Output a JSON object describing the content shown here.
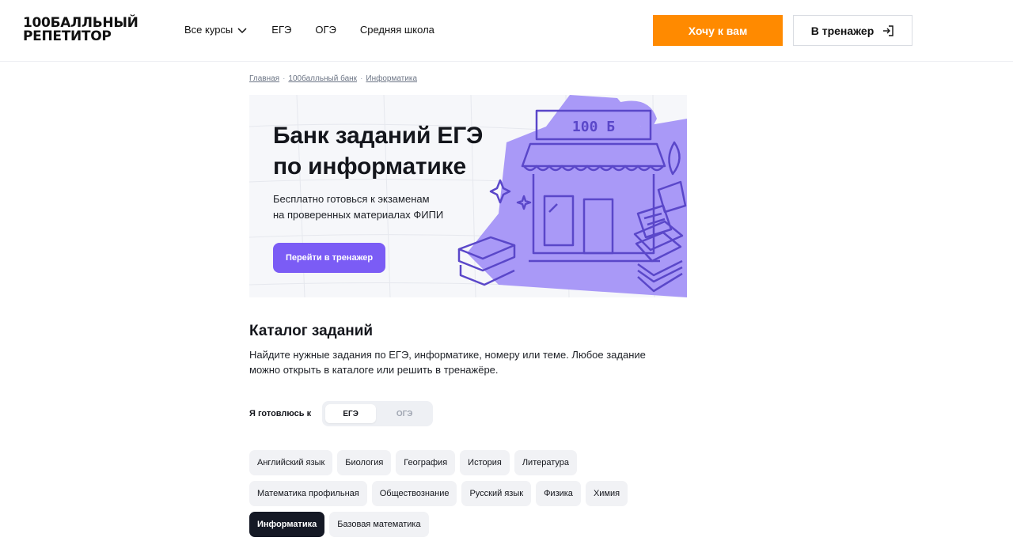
{
  "header": {
    "logo_line1": "100БАЛЛЬНЫЙ",
    "logo_line2": "РЕПЕТИТОР",
    "nav": [
      {
        "label": "Все курсы",
        "has_dropdown": true
      },
      {
        "label": "ЕГЭ"
      },
      {
        "label": "ОГЭ"
      },
      {
        "label": "Средняя школа"
      }
    ],
    "cta_label": "Хочу к вам",
    "trainer_label": "В тренажер",
    "accent_color": "#ff8a00"
  },
  "breadcrumb": [
    "Главная",
    "100балльный банк",
    "Информатика"
  ],
  "hero": {
    "title_line1": "Банк заданий ЕГЭ",
    "title_line2": "по информатике",
    "subtitle_line1": "Бесплатно готовься к экзаменам",
    "subtitle_line2": "на проверенных материалах ФИПИ",
    "button_label": "Перейти в тренажер",
    "button_color": "#7b5cf5",
    "sign_text": "100 Б"
  },
  "catalog": {
    "title": "Каталог заданий",
    "desc_line1": "Найдите нужные задания по ЕГЭ, информатике, номеру или теме. Любое задание",
    "desc_line2": "можно открыть в каталоге или решить в тренажёре.",
    "prep_label": "Я готовлюсь к",
    "exam_options": [
      {
        "label": "ЕГЭ",
        "selected": true
      },
      {
        "label": "ОГЭ",
        "selected": false
      }
    ],
    "subject_rows": [
      [
        "Английский язык",
        "Биология",
        "География",
        "История",
        "Литература"
      ],
      [
        "Математика профильная",
        "Обществознание",
        "Русский язык",
        "Физика",
        "Химия"
      ],
      [
        "Информатика",
        "Базовая математика"
      ]
    ],
    "selected_subject": "Информатика"
  }
}
